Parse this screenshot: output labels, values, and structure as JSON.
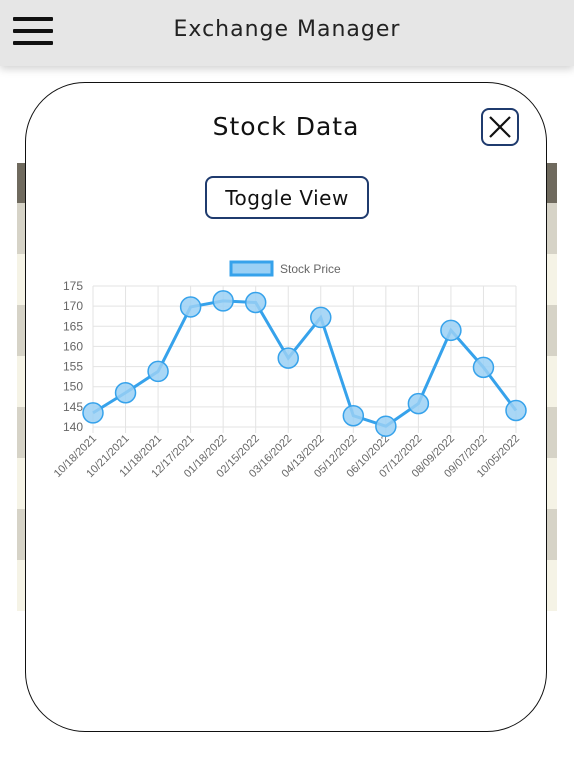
{
  "app": {
    "title": "Exchange Manager"
  },
  "modal": {
    "title": "Stock Data",
    "toggle_label": "Toggle View"
  },
  "chart_data": {
    "type": "line",
    "categories": [
      "10/18/2021",
      "10/21/2021",
      "11/18/2021",
      "12/17/2021",
      "01/18/2022",
      "02/15/2022",
      "03/16/2022",
      "04/13/2022",
      "05/12/2022",
      "06/10/2022",
      "07/12/2022",
      "08/09/2022",
      "09/07/2022",
      "10/05/2022"
    ],
    "series": [
      {
        "name": "Stock Price",
        "values": [
          143.5,
          148.5,
          153.8,
          169.8,
          171.3,
          170.9,
          157.1,
          167.2,
          142.8,
          140.2,
          145.8,
          164.0,
          154.8,
          144.1
        ]
      }
    ],
    "ylim": [
      140,
      175
    ],
    "yticks": [
      140,
      145,
      150,
      155,
      160,
      165,
      170,
      175
    ],
    "legend": "top",
    "grid": true,
    "colors": {
      "line": "#36a2eb",
      "fill": "#9ad0f5"
    }
  }
}
